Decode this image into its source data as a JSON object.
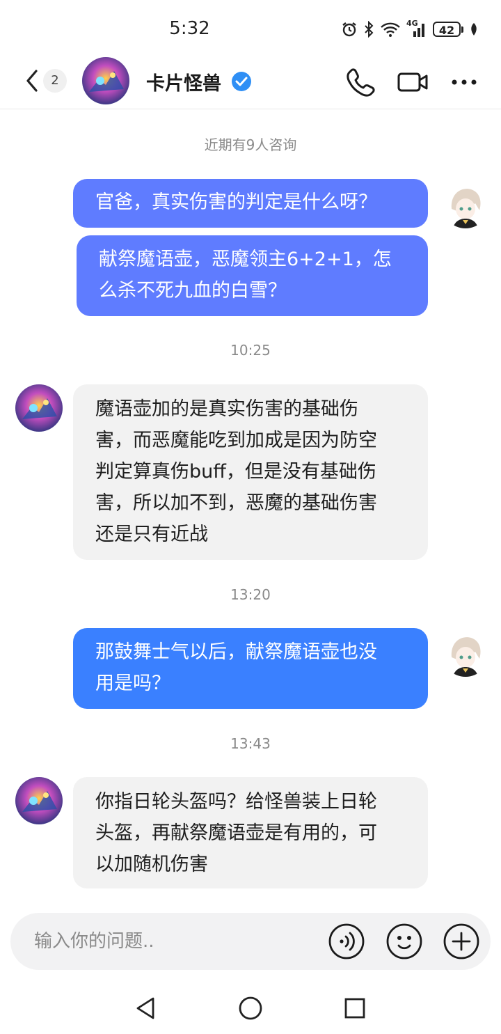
{
  "status_bar": {
    "time": "5:32",
    "network": "4G",
    "battery": "42"
  },
  "header": {
    "unread_count": "2",
    "contact_name": "卡片怪兽",
    "accent_color": "#2f8ff5"
  },
  "chat": {
    "notice": "近期有9人咨询",
    "messages": [
      {
        "direction": "out",
        "text": "官爸，真实伤害的判定是什么呀？",
        "bubble_color": "#5f7cff"
      },
      {
        "direction": "out",
        "text": "献祭魔语壶，恶魔领主6+2+1，怎\n么杀不死九血的白雪？",
        "bubble_color": "#5f7cff"
      },
      {
        "time": "10:25"
      },
      {
        "direction": "in",
        "text": "魔语壶加的是真实伤害的基础伤\n害，而恶魔能吃到加成是因为防空\n判定算真伤buff，但是没有基础伤\n害，所以加不到，恶魔的基础伤害\n还是只有近战"
      },
      {
        "time": "13:20"
      },
      {
        "direction": "out",
        "text": "那鼓舞士气以后，献祭魔语壶也没\n用是吗？",
        "bubble_color": "#3a80ff"
      },
      {
        "time": "13:43"
      },
      {
        "direction": "in",
        "text": "你指日轮头盔吗？给怪兽装上日轮\n头盔，再献祭魔语壶是有用的，可\n以加随机伤害"
      }
    ]
  },
  "input": {
    "placeholder": "输入你的问题.."
  },
  "icons": {
    "back": "chevron-left-icon",
    "call": "phone-icon",
    "video": "video-camera-icon",
    "more": "more-dots-icon",
    "voice": "voice-icon",
    "emoji": "emoji-icon",
    "add": "add-icon",
    "nav_back": "triangle-back-icon",
    "nav_home": "circle-home-icon",
    "nav_recent": "square-recent-icon"
  }
}
